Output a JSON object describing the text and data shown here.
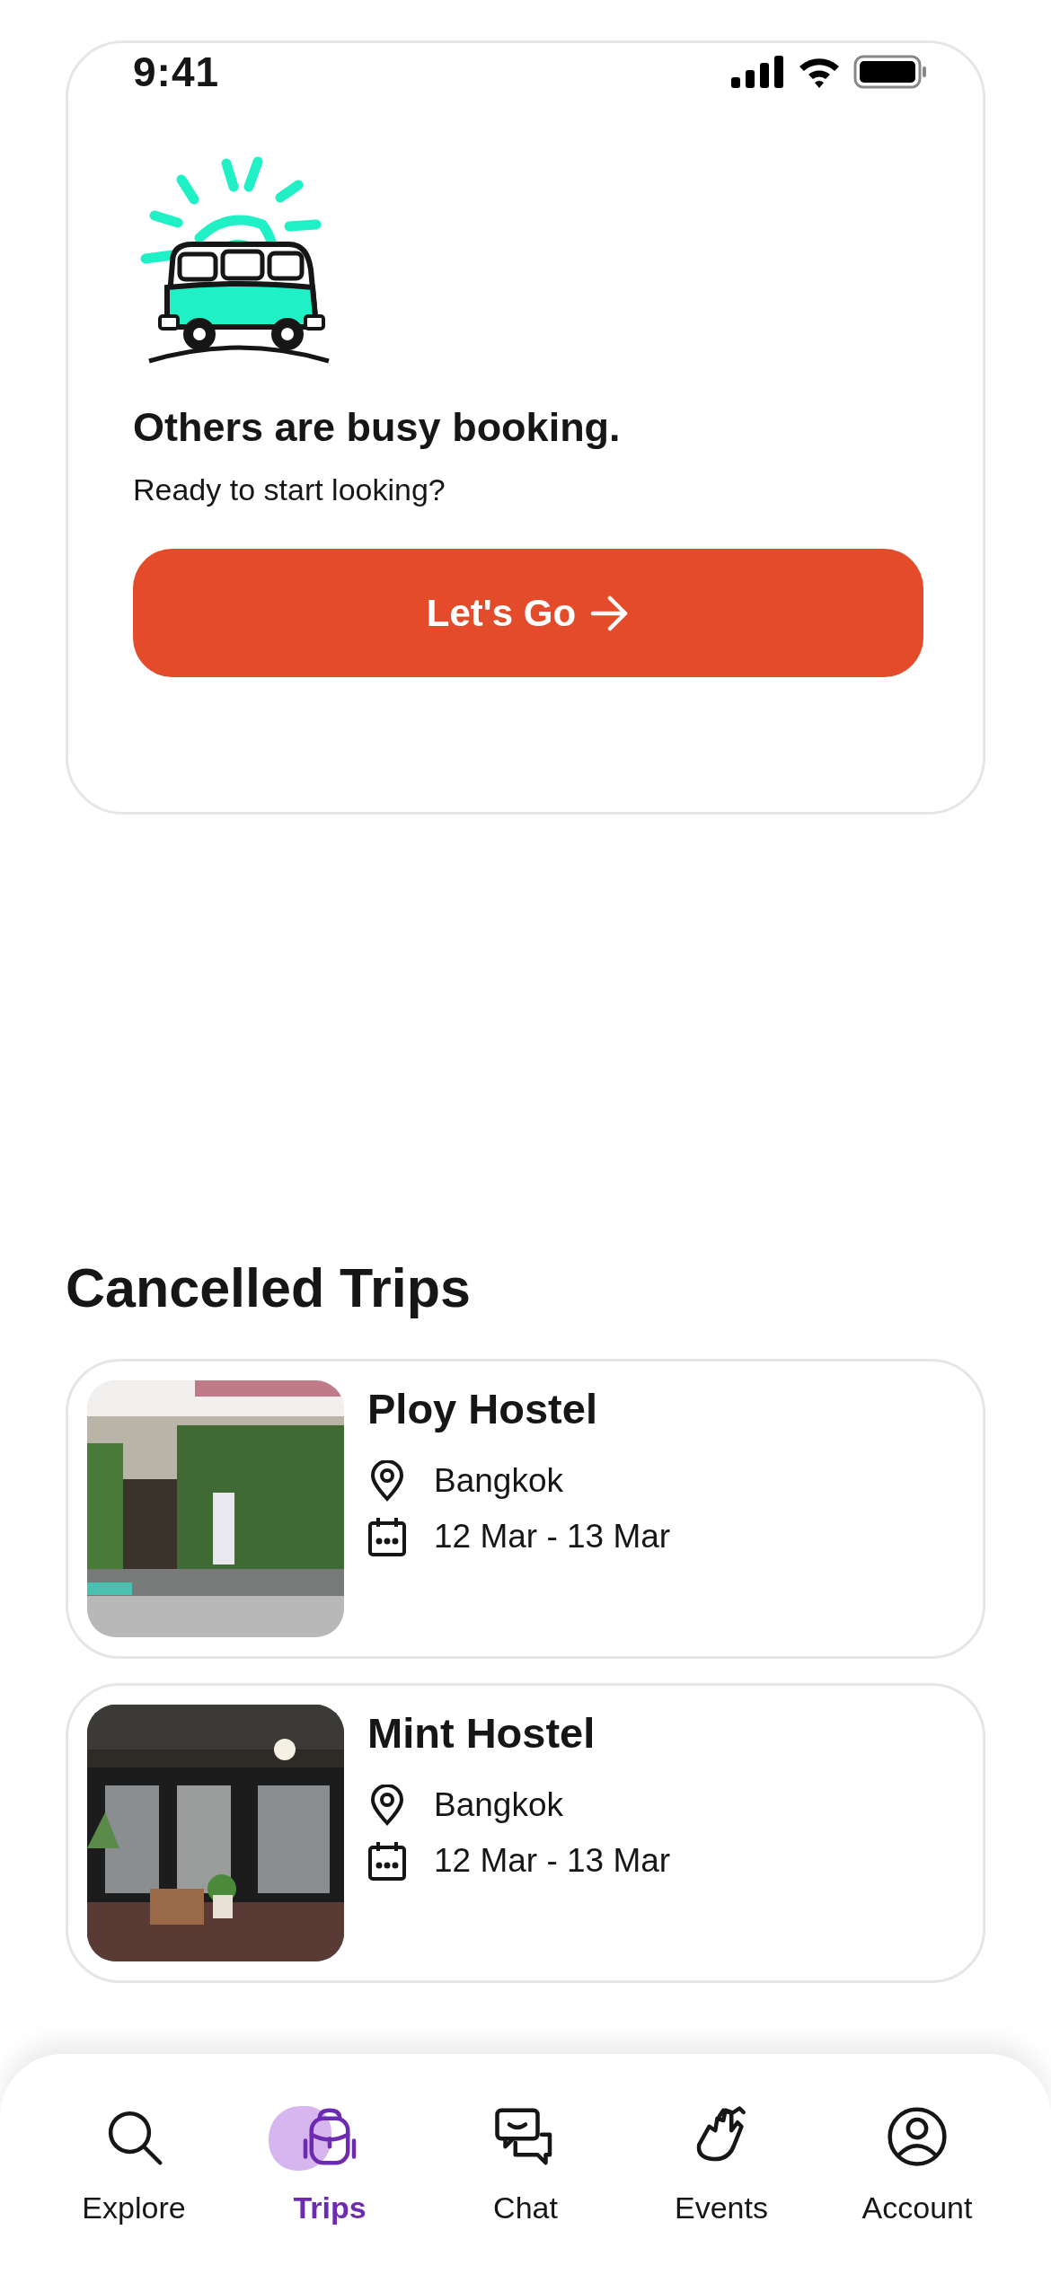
{
  "status_bar": {
    "time": "9:41"
  },
  "empty_state": {
    "title": "Others are busy booking.",
    "subtitle": "Ready to start looking?",
    "button": "Let's Go"
  },
  "cancelled_trips": {
    "heading": "Cancelled Trips",
    "trips": [
      {
        "name": "Ploy Hostel",
        "location": "Bangkok",
        "dates": "12 Mar - 13 Mar"
      },
      {
        "name": "Mint Hostel",
        "location": "Bangkok",
        "dates": "12 Mar - 13 Mar"
      }
    ]
  },
  "tab_bar": [
    {
      "label": "Explore",
      "selected": false
    },
    {
      "label": "Trips",
      "selected": true
    },
    {
      "label": "Chat",
      "selected": false
    },
    {
      "label": "Events",
      "selected": false
    },
    {
      "label": "Account",
      "selected": false
    }
  ]
}
